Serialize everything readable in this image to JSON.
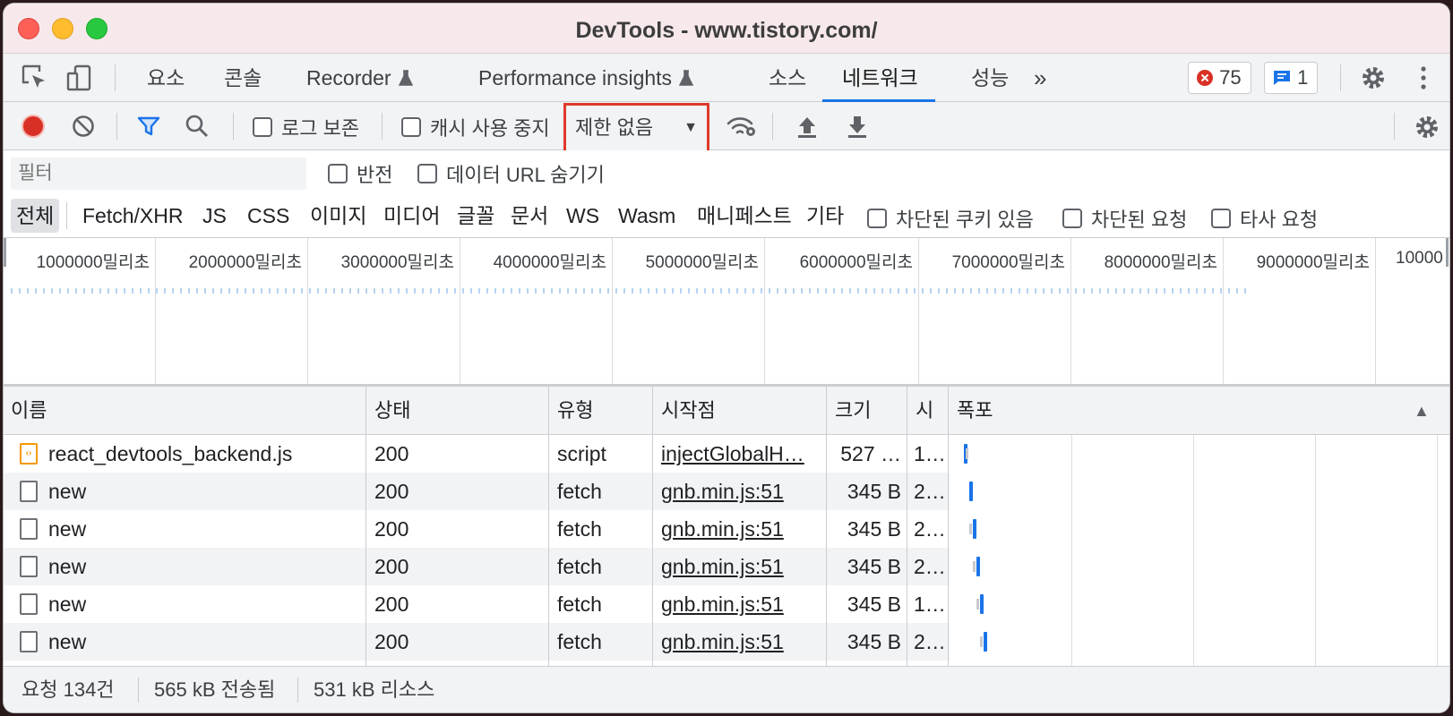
{
  "window": {
    "title": "DevTools - www.tistory.com/"
  },
  "tabs": [
    {
      "label": "요소"
    },
    {
      "label": "콘솔"
    },
    {
      "label": "Recorder"
    },
    {
      "label": "Performance insights"
    },
    {
      "label": "소스"
    },
    {
      "label": "네트워크",
      "active": true
    },
    {
      "label": "성능"
    },
    {
      "label": "»"
    }
  ],
  "badges": {
    "errors": "75",
    "messages": "1"
  },
  "toolbar": {
    "preserve_log": "로그 보존",
    "disable_cache": "캐시 사용 중지",
    "throttling": "제한 없음"
  },
  "filter": {
    "placeholder": "필터",
    "invert": "반전",
    "hide_data_urls": "데이터 URL 숨기기"
  },
  "types": [
    "전체",
    "Fetch/XHR",
    "JS",
    "CSS",
    "이미지",
    "미디어",
    "글꼴",
    "문서",
    "WS",
    "Wasm",
    "매니페스트",
    "기타"
  ],
  "type_checkboxes": [
    "차단된 쿠키 있음",
    "차단된 요청",
    "타사 요청"
  ],
  "overview_ticks": [
    "1000000밀리초",
    "2000000밀리초",
    "3000000밀리초",
    "4000000밀리초",
    "5000000밀리초",
    "6000000밀리초",
    "7000000밀리초",
    "8000000밀리초",
    "9000000밀리초",
    "10000"
  ],
  "columns": [
    "이름",
    "상태",
    "유형",
    "시작점",
    "크기",
    "시",
    "폭포"
  ],
  "sort_indicator": "▲",
  "requests": [
    {
      "name": "react_devtools_backend.js",
      "status": "200",
      "type": "script",
      "initiator": "injectGlobalH…",
      "size": "527 …",
      "time": "1…",
      "icon": "js-file-icon"
    },
    {
      "name": "new",
      "status": "200",
      "type": "fetch",
      "initiator": "gnb.min.js:51",
      "size": "345 B",
      "time": "2…",
      "icon": "document-icon"
    },
    {
      "name": "new",
      "status": "200",
      "type": "fetch",
      "initiator": "gnb.min.js:51",
      "size": "345 B",
      "time": "2…",
      "icon": "document-icon"
    },
    {
      "name": "new",
      "status": "200",
      "type": "fetch",
      "initiator": "gnb.min.js:51",
      "size": "345 B",
      "time": "2…",
      "icon": "document-icon"
    },
    {
      "name": "new",
      "status": "200",
      "type": "fetch",
      "initiator": "gnb.min.js:51",
      "size": "345 B",
      "time": "1…",
      "icon": "document-icon"
    },
    {
      "name": "new",
      "status": "200",
      "type": "fetch",
      "initiator": "gnb.min.js:51",
      "size": "345 B",
      "time": "2…",
      "icon": "document-icon"
    }
  ],
  "status": {
    "requests": "요청 134건",
    "transferred": "565 kB 전송됨",
    "resources": "531 kB 리소스"
  },
  "colors": {
    "accent": "#1a73e8",
    "record": "#d93025",
    "highlight_border": "#e03a2a"
  }
}
